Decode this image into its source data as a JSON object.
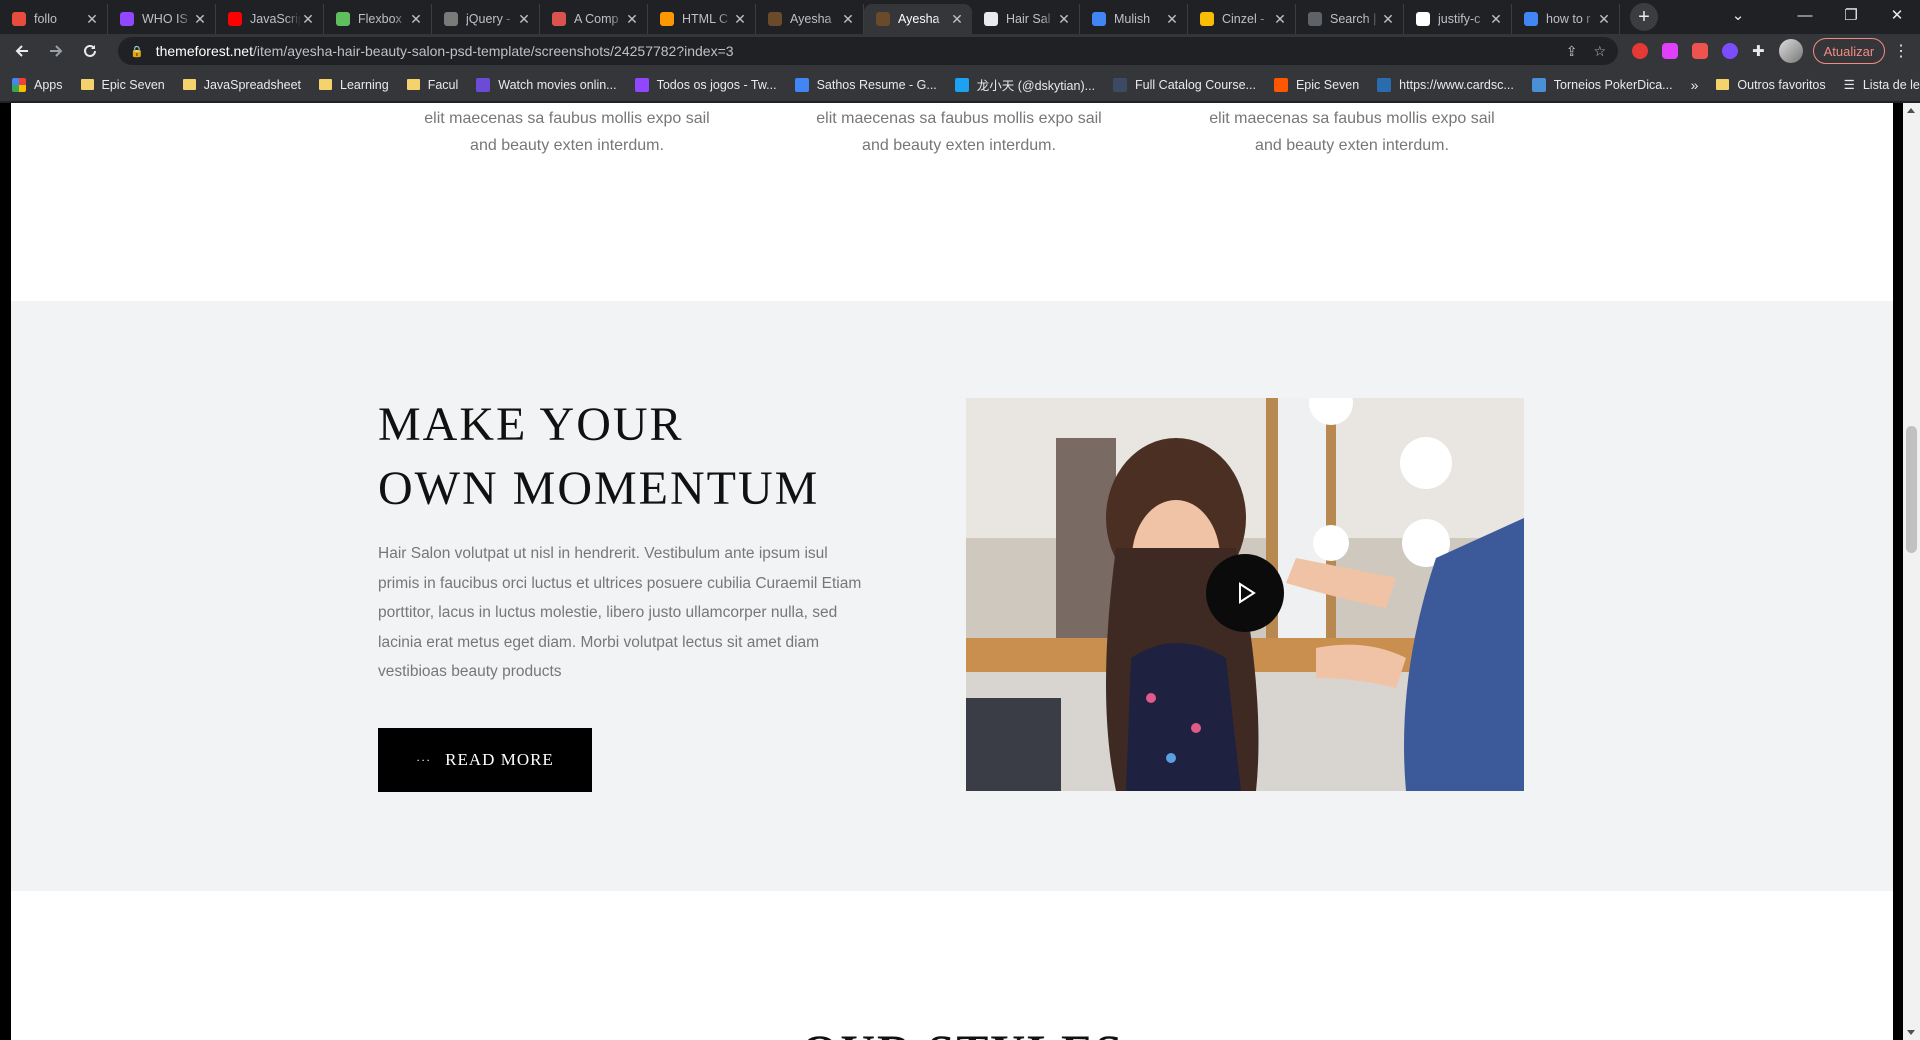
{
  "browser": {
    "tabs": [
      {
        "title": "follo",
        "color": "#e74c3c",
        "active": false
      },
      {
        "title": "WHO IS",
        "color": "#9146ff",
        "active": false
      },
      {
        "title": "JavaScrip",
        "color": "#ff0000",
        "active": false
      },
      {
        "title": "Flexbox",
        "color": "#5fbf5f",
        "active": false
      },
      {
        "title": "jQuery -",
        "color": "#7a7a7a",
        "active": false
      },
      {
        "title": "A Comp",
        "color": "#d9534f",
        "active": false
      },
      {
        "title": "HTML C",
        "color": "#ff9800",
        "active": false
      },
      {
        "title": "Ayesha",
        "color": "#6b4a2b",
        "active": false
      },
      {
        "title": "Ayesha",
        "color": "#6b4a2b",
        "active": true
      },
      {
        "title": "Hair Sal",
        "color": "#e8eaed",
        "active": false
      },
      {
        "title": "Mulish",
        "color": "#4285f4",
        "active": false
      },
      {
        "title": "Cinzel -",
        "color": "#fbbc04",
        "active": false
      },
      {
        "title": "Search |",
        "color": "#5f6368",
        "active": false
      },
      {
        "title": "justify-c",
        "color": "#ffffff",
        "active": false
      },
      {
        "title": "how to r",
        "color": "#4285f4",
        "active": false
      }
    ],
    "url_host": "themeforest.net",
    "url_path": "/item/ayesha-hair-beauty-salon-psd-template/screenshots/24257782?index=3",
    "update_label": "Atualizar",
    "bookmarks": [
      {
        "label": "Apps",
        "type": "apps"
      },
      {
        "label": "Epic Seven",
        "type": "folder"
      },
      {
        "label": "JavaSpreadsheet",
        "type": "folder"
      },
      {
        "label": "Learning",
        "type": "folder"
      },
      {
        "label": "Facul",
        "type": "folder"
      },
      {
        "label": "Watch movies onlin...",
        "type": "site",
        "color": "#6c4bd6"
      },
      {
        "label": "Todos os jogos - Tw...",
        "type": "site",
        "color": "#9146ff"
      },
      {
        "label": "Sathos Resume - G...",
        "type": "site",
        "color": "#4285f4"
      },
      {
        "label": "龙小天 (@dskytian)...",
        "type": "site",
        "color": "#1da1f2"
      },
      {
        "label": "Full Catalog Course...",
        "type": "site",
        "color": "#3c4a63"
      },
      {
        "label": "Epic Seven",
        "type": "site",
        "color": "#ff5700"
      },
      {
        "label": "https://www.cardsc...",
        "type": "site",
        "color": "#2b6cb0"
      },
      {
        "label": "Torneios PokerDica...",
        "type": "site",
        "color": "#4a90d9"
      }
    ],
    "bookmarks_more": "»",
    "other_bookmarks": "Outros favoritos",
    "reading_list": "Lista de leitura"
  },
  "page": {
    "features": [
      {
        "line1": "elit maecenas sa faubus mollis expo sail",
        "line2": "and beauty exten interdum."
      },
      {
        "line1": "elit maecenas sa faubus mollis expo sail",
        "line2": "and beauty exten interdum."
      },
      {
        "line1": "elit maecenas sa faubus mollis expo sail",
        "line2": "and beauty exten interdum."
      }
    ],
    "headline_line1": "MAKE YOUR",
    "headline_line2": "OWN MOMENTUM",
    "description": "Hair Salon volutpat ut nisl in hendrerit. Vestibulum ante ipsum isul primis in faucibus orci luctus et ultrices posuere cubilia Curaemil Etiam porttitor, lacus in luctus molestie, libero justo ullamcorper nulla, sed lacinia erat metus eget diam. Morbi volutpat lectus sit amet diam vestibioas beauty products",
    "read_more": "READ MORE",
    "read_more_prefix": "···",
    "next_section_title": "OUR STYLES"
  }
}
